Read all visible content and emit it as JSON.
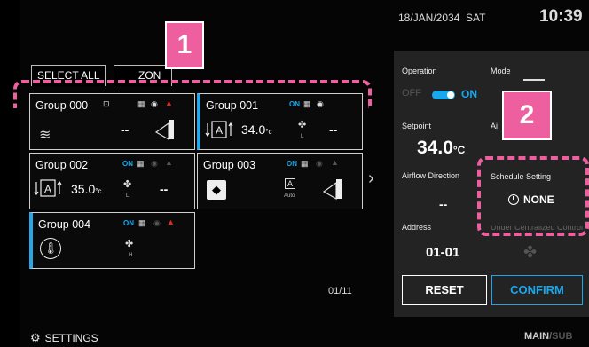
{
  "header": {
    "date": "18/JAN/2034  SAT",
    "time": "10:39"
  },
  "toolbar": {
    "select_all": "SELECT ALL",
    "zone": "ZON"
  },
  "groups": [
    {
      "name": "Group 000",
      "status": "",
      "temp": "",
      "unit": "",
      "dash": "--",
      "fan_label": ""
    },
    {
      "name": "Group 001",
      "status": "ON",
      "temp": "34.0",
      "unit": "°c",
      "dash": "--",
      "fan_label": "L"
    },
    {
      "name": "Group 002",
      "status": "ON",
      "temp": "35.0",
      "unit": "°c",
      "dash": "--",
      "fan_label": "L"
    },
    {
      "name": "Group 003",
      "status": "ON",
      "temp": "",
      "unit": "",
      "dash": "--",
      "fan_label": "Auto"
    },
    {
      "name": "Group 004",
      "status": "ON",
      "temp": "",
      "unit": "",
      "dash": "--",
      "fan_label": "H"
    }
  ],
  "pagination": {
    "page": "01/11"
  },
  "panel": {
    "operation_label": "Operation",
    "mode_label": "Mode",
    "off_label": "OFF",
    "on_label": "ON",
    "setpoint_label": "Setpoint",
    "airflow_cut_label": "Ai",
    "setpoint_value": "34.0",
    "setpoint_unit": "°C",
    "airflow_direction_label": "Airflow Direction",
    "airflow_direction_value": "--",
    "schedule_label": "Schedule Setting",
    "schedule_value": "NONE",
    "address_label": "Address",
    "address_value": "01-01",
    "centralized_label": "Under Centralized Control",
    "reset": "RESET",
    "confirm": "CONFIRM"
  },
  "footer": {
    "settings": "SETTINGS",
    "main": "MAIN",
    "sub": "SUB"
  },
  "callouts": {
    "one": "1",
    "two": "2"
  },
  "colors": {
    "accent": "#19a8ee",
    "callout": "#ee5fa0",
    "alert": "#e5271d"
  }
}
